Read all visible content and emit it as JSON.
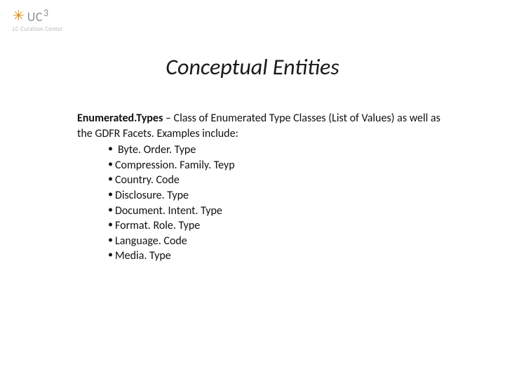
{
  "logo": {
    "brand_prefix": "UC",
    "brand_suffix": "3",
    "subline": "LC Curation Center"
  },
  "title": "Conceptual Entities",
  "lead": {
    "term": "Enumerated.Types",
    "sep": " – ",
    "rest": "Class of Enumerated Type Classes (List of Values) as well as the GDFR Facets. Examples include:"
  },
  "bullets": [
    " Byte. Order. Type",
    " Compression. Family. Teyp",
    " Country. Code",
    " Disclosure. Type",
    " Document. Intent. Type",
    " Format. Role. Type",
    " Language. Code",
    " Media. Type"
  ]
}
